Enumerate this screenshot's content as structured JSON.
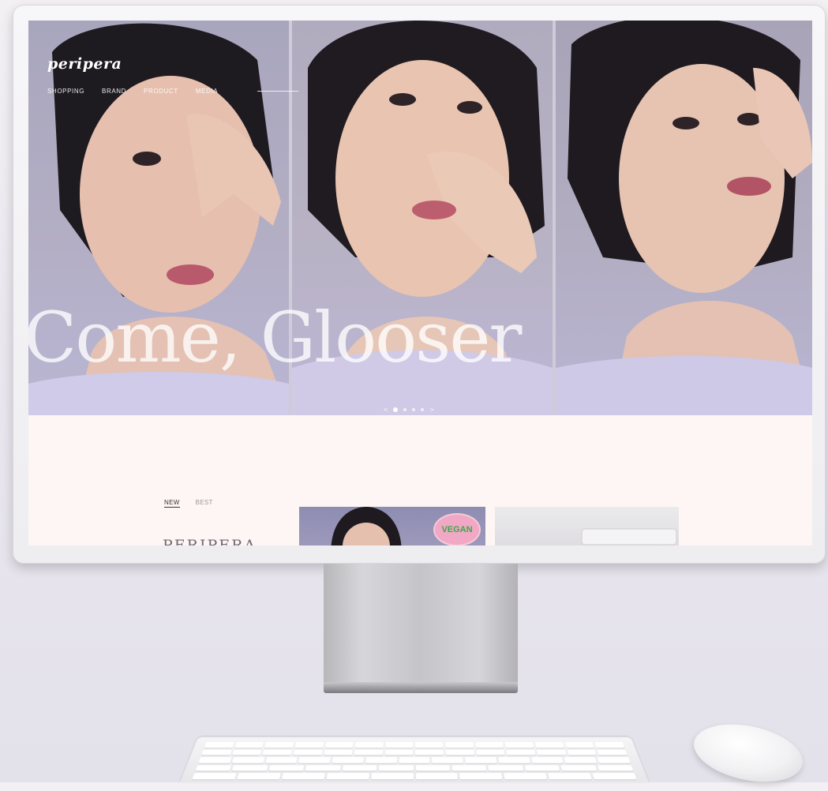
{
  "nav": {
    "logo": "peripera",
    "menu": [
      "SHOPPING",
      "BRAND",
      "PRODUCT",
      "MEDIA"
    ]
  },
  "hero": {
    "headline": "Come, Glooser",
    "pager": {
      "prev": "<",
      "next": ">",
      "slides": 5,
      "active": 1
    }
  },
  "product_tabs": [
    "NEW",
    "BEST"
  ],
  "brand_heading": "PERIPERA",
  "badge": "VEGAN",
  "colors": {
    "screen_bg": "#fdf6f4",
    "hero_tint": "#b3aec4"
  }
}
